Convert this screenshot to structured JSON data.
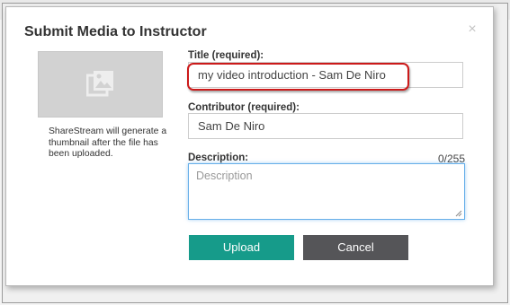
{
  "modal": {
    "title": "Submit Media to Instructor",
    "close_symbol": "×"
  },
  "thumbnail": {
    "icon": "image-gallery-icon",
    "note": "ShareStream will generate a thumbnail after the file has been uploaded."
  },
  "form": {
    "title_label": "Title (required):",
    "title_value": "my video introduction - Sam De Niro",
    "contributor_label": "Contributor (required):",
    "contributor_value": "Sam De Niro",
    "description_label": "Description:",
    "description_counter": "0/255",
    "description_placeholder": "Description"
  },
  "buttons": {
    "upload": "Upload",
    "cancel": "Cancel"
  },
  "colors": {
    "upload_bg": "#169b8a",
    "cancel_bg": "#555558",
    "highlight": "#cc1a1a",
    "focus": "#66afe9"
  }
}
